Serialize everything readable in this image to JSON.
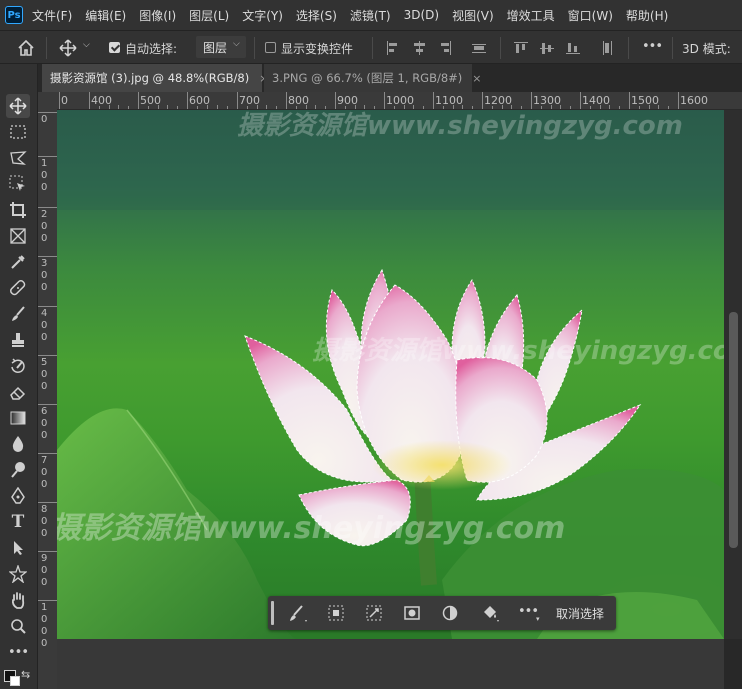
{
  "app": {
    "logo_text": "Ps"
  },
  "menu": [
    "文件(F)",
    "编辑(E)",
    "图像(I)",
    "图层(L)",
    "文字(Y)",
    "选择(S)",
    "滤镜(T)",
    "3D(D)",
    "视图(V)",
    "增效工具",
    "窗口(W)",
    "帮助(H)"
  ],
  "options_bar": {
    "auto_select_label": "自动选择:",
    "auto_select_checked": true,
    "auto_select_target": "图层",
    "show_transform_label": "显示变换控件",
    "show_transform_checked": false,
    "more_label": "•••",
    "mode_label": "3D 模式:"
  },
  "tabs": [
    {
      "label": "摄影资源馆 (3).jpg @ 48.8%(RGB/8)",
      "close": "×",
      "active": true
    },
    {
      "label": "3.PNG @ 66.7% (图层 1, RGB/8#)",
      "close": "×",
      "active": false
    }
  ],
  "ruler": {
    "h_labels": [
      "0",
      "400",
      "500",
      "600",
      "700",
      "800",
      "900",
      "1000",
      "1100",
      "1200",
      "1300",
      "1400",
      "1500",
      "1600"
    ],
    "v_labels": [
      "0",
      "100",
      "200",
      "300",
      "400",
      "500",
      "600",
      "700",
      "800",
      "900",
      "1000"
    ]
  },
  "tools": [
    "move-tool",
    "marquee-tool",
    "lasso-tool",
    "object-select-tool",
    "crop-tool",
    "frame-tool",
    "eyedropper-tool",
    "healing-brush-tool",
    "brush-tool",
    "clone-stamp-tool",
    "history-brush-tool",
    "eraser-tool",
    "gradient-tool",
    "blur-tool",
    "dodge-tool",
    "pen-tool",
    "type-tool",
    "path-select-tool",
    "shape-tool",
    "hand-tool",
    "zoom-tool",
    "more-tools"
  ],
  "type_tool_label": "T",
  "watermarks": [
    "摄影资源馆www.sheyingzyg.com",
    "摄影资源馆www.sheyingzyg.com",
    "摄影资源馆www.sheyingzyg.com"
  ],
  "context_bar": {
    "more_label": "•••",
    "deselect_label": "取消选择"
  },
  "colors": {
    "accent": "#31a8ff",
    "panel": "#323232",
    "lotus_pink": "#e8609e"
  }
}
